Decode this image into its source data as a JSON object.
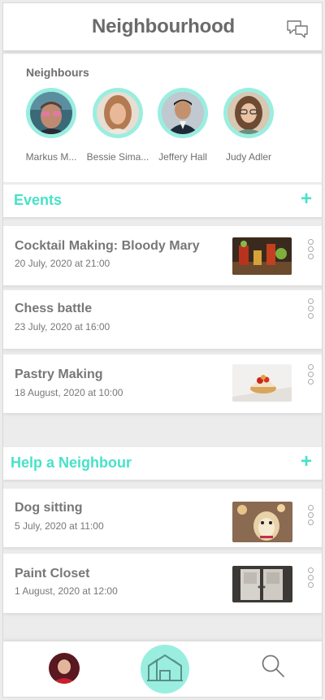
{
  "header": {
    "title": "Neighbourhood",
    "chat_icon": "chat-bubbles-icon"
  },
  "neighbours": {
    "label": "Neighbours",
    "items": [
      {
        "name": "Markus M..."
      },
      {
        "name": "Bessie Sima..."
      },
      {
        "name": "Jeffery Hall"
      },
      {
        "name": "Judy Adler"
      }
    ]
  },
  "events": {
    "title": "Events",
    "add_label": "+",
    "items": [
      {
        "title": "Cocktail Making: Bloody Mary",
        "date": "20 July, 2020 at 21:00",
        "has_thumb": true
      },
      {
        "title": "Chess battle",
        "date": "23 July, 2020 at 16:00",
        "has_thumb": false
      },
      {
        "title": "Pastry Making",
        "date": "18 August, 2020 at 10:00",
        "has_thumb": true
      }
    ]
  },
  "help": {
    "title": "Help a Neighbour",
    "add_label": "+",
    "items": [
      {
        "title": "Dog sitting",
        "date": "5 July, 2020 at 11:00",
        "has_thumb": true
      },
      {
        "title": "Paint Closet",
        "date": "1 August, 2020 at 12:00",
        "has_thumb": true
      }
    ]
  },
  "bottom_nav": {
    "items": [
      "profile-avatar",
      "home-icon",
      "search-icon"
    ]
  },
  "colors": {
    "accent": "#47e2c8",
    "accent_light": "#9aeee0",
    "text": "#777777",
    "background": "#ececec"
  }
}
